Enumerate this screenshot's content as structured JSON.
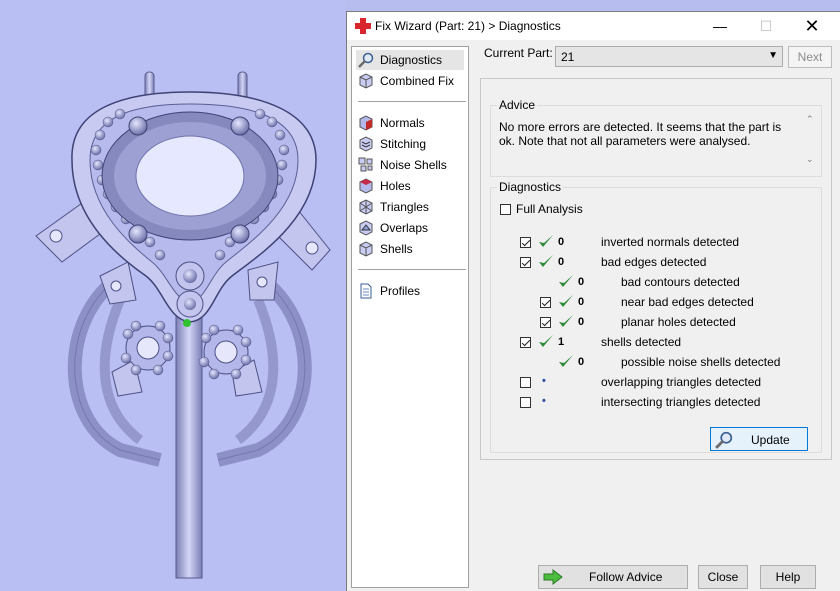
{
  "window": {
    "title": "Fix Wizard (Part: 21) > Diagnostics",
    "app_icon": "red-cross-icon",
    "controls": [
      "minimize-icon",
      "maximize-icon",
      "close-icon"
    ]
  },
  "nav": {
    "items": [
      {
        "label": "Diagnostics",
        "icon": "magnifier-icon",
        "selected": true
      },
      {
        "label": "Combined Fix",
        "icon": "cube-icon"
      },
      {
        "label": "Normals",
        "icon": "normals-cube-icon"
      },
      {
        "label": "Stitching",
        "icon": "stitching-icon"
      },
      {
        "label": "Noise Shells",
        "icon": "noise-shells-icon"
      },
      {
        "label": "Holes",
        "icon": "holes-icon"
      },
      {
        "label": "Triangles",
        "icon": "triangles-icon"
      },
      {
        "label": "Overlaps",
        "icon": "overlaps-icon"
      },
      {
        "label": "Shells",
        "icon": "shells-icon"
      },
      {
        "label": "Profiles",
        "icon": "document-icon"
      }
    ]
  },
  "current_part": {
    "label": "Current Part:",
    "value": "21",
    "next_label": "Next"
  },
  "advice": {
    "title": "Advice",
    "text": "No more errors are detected. It seems that the part is ok. Note that not all parameters were analysed."
  },
  "diagnostics": {
    "title": "Diagnostics",
    "full_analysis_label": "Full Analysis",
    "full_analysis_checked": false,
    "rows": [
      {
        "label": "inverted normals detected",
        "count": "0",
        "checkbox": true,
        "checked": true,
        "status": "ok"
      },
      {
        "label": "bad edges detected",
        "count": "0",
        "checkbox": true,
        "checked": true,
        "status": "ok"
      },
      {
        "label": "bad contours detected",
        "count": "0",
        "checkbox": false,
        "status": "ok",
        "indent": true
      },
      {
        "label": "near bad edges detected",
        "count": "0",
        "checkbox": true,
        "checked": true,
        "status": "ok",
        "indent": true
      },
      {
        "label": "planar holes detected",
        "count": "0",
        "checkbox": true,
        "checked": true,
        "status": "ok",
        "indent": true
      },
      {
        "label": "shells detected",
        "count": "1",
        "checkbox": true,
        "checked": true,
        "status": "ok"
      },
      {
        "label": "possible noise shells detected",
        "count": "0",
        "checkbox": false,
        "status": "ok",
        "indent": true
      },
      {
        "label": "overlapping triangles detected",
        "count": "",
        "checkbox": true,
        "checked": false,
        "status": "pending"
      },
      {
        "label": "intersecting triangles detected",
        "count": "",
        "checkbox": true,
        "checked": false,
        "status": "pending"
      }
    ],
    "update_label": "Update"
  },
  "footer": {
    "follow_label": "Follow Advice",
    "close_label": "Close",
    "help_label": "Help"
  },
  "colors": {
    "viewport_bg": "#b9bef3",
    "model": "#a9acdc",
    "check_green": "#2e8b3a",
    "accent": "#0078d7"
  }
}
